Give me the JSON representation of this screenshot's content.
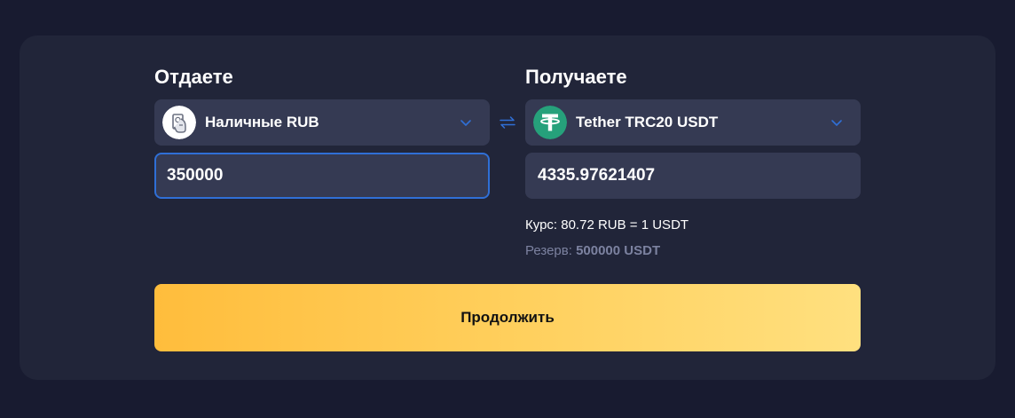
{
  "give": {
    "title": "Отдаете",
    "currency": {
      "label": "Наличные RUB",
      "icon": "cash-rub-icon"
    },
    "amount": "350000"
  },
  "receive": {
    "title": "Получаете",
    "currency": {
      "label": "Tether TRC20 USDT",
      "icon": "tether-icon"
    },
    "amount": "4335.97621407"
  },
  "exchange_info": {
    "rate": "Курс: 80.72 RUB = 1 USDT",
    "reserve_label": "Резерв:",
    "reserve_value": "500000 USDT"
  },
  "continue_label": "Продолжить",
  "colors": {
    "page_background": "#181b30",
    "panel": "#212539",
    "field": "#353a53",
    "focus_border": "#2f6fd6",
    "tether_green": "#26a17b",
    "button_gradient_start": "#ffbd3c",
    "button_gradient_end": "#ffe07f"
  }
}
